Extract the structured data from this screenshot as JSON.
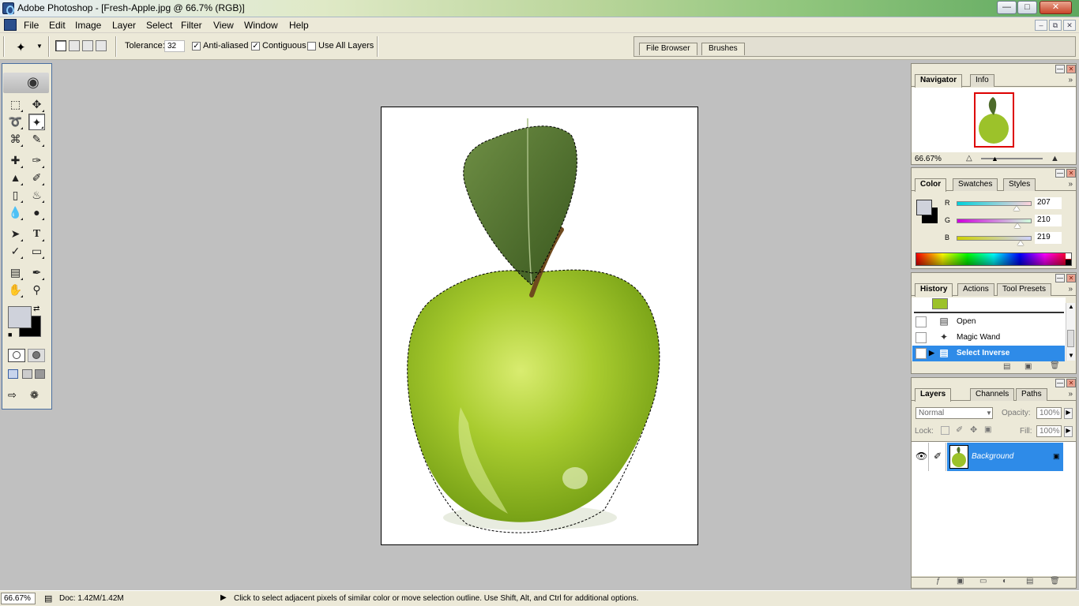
{
  "window": {
    "title": "Adobe Photoshop - [Fresh-Apple.jpg @ 66.7% (RGB)]",
    "minimize_icon": "minimize-icon",
    "maximize_icon": "maximize-icon",
    "close_icon": "close-icon"
  },
  "menu": {
    "items": [
      "File",
      "Edit",
      "Image",
      "Layer",
      "Select",
      "Filter",
      "View",
      "Window",
      "Help"
    ]
  },
  "options": {
    "tolerance_label": "Tolerance:",
    "tolerance_value": "32",
    "anti_aliased_label": "Anti-aliased",
    "anti_aliased_checked": true,
    "contiguous_label": "Contiguous",
    "contiguous_checked": true,
    "use_all_layers_label": "Use All Layers",
    "use_all_layers_checked": false,
    "well_tabs": [
      "File Browser",
      "Brushes"
    ]
  },
  "toolbox": {
    "tools": [
      "marquee",
      "move",
      "lasso",
      "magic-wand",
      "crop",
      "slice",
      "healing-brush",
      "brush",
      "clone-stamp",
      "history-brush",
      "eraser",
      "paint-bucket",
      "blur",
      "dodge",
      "path-selection",
      "type",
      "pen",
      "shape",
      "notes",
      "eyedropper",
      "hand",
      "zoom"
    ],
    "selected_tool": "magic-wand",
    "foreground_color": "#cfd2db",
    "background_color": "#000000"
  },
  "navigator": {
    "tabs": [
      "Navigator",
      "Info"
    ],
    "zoom": "66.67%"
  },
  "color": {
    "tabs": [
      "Color",
      "Swatches",
      "Styles"
    ],
    "r_label": "R",
    "r_value": "207",
    "g_label": "G",
    "g_value": "210",
    "b_label": "B",
    "b_value": "219"
  },
  "history": {
    "tabs": [
      "History",
      "Actions",
      "Tool Presets"
    ],
    "items": [
      "Open",
      "Magic Wand",
      "Select Inverse"
    ],
    "selected": "Select Inverse"
  },
  "layers": {
    "tabs": [
      "Layers",
      "Channels",
      "Paths"
    ],
    "blend_mode": "Normal",
    "opacity_label": "Opacity:",
    "opacity_value": "100%",
    "lock_label": "Lock:",
    "fill_label": "Fill:",
    "fill_value": "100%",
    "layer_name": "Background"
  },
  "status": {
    "zoom": "66.67%",
    "doc": "Doc: 1.42M/1.42M",
    "hint": "Click to select adjacent pixels of similar color or move selection outline.  Use Shift, Alt, and Ctrl for additional options."
  },
  "colors": {
    "selection_blue": "#2e8be8",
    "apple_green": "#9cc22a",
    "canvas_bg": "#c0c0c0"
  }
}
